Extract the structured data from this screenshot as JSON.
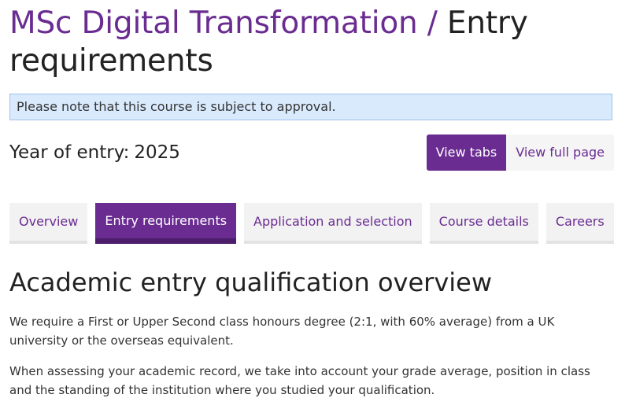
{
  "header": {
    "programme": "MSc Digital Transformation",
    "separator": " / ",
    "section": "Entry requirements"
  },
  "notice": {
    "text": "Please note that this course is subject to approval."
  },
  "entry": {
    "label": "Year of entry:",
    "year": "2025"
  },
  "view_toggle": {
    "tabs_label": "View tabs",
    "full_label": "View full page",
    "active": "tabs"
  },
  "tabs": [
    {
      "label": "Overview"
    },
    {
      "label": "Entry requirements",
      "active": true
    },
    {
      "label": "Application and selection"
    },
    {
      "label": "Course details"
    },
    {
      "label": "Careers"
    }
  ],
  "content": {
    "heading": "Academic entry qualification overview",
    "paragraphs": [
      "We require a First or Upper Second class honours degree (2:1, with 60% average) from a UK university or the overseas equivalent.",
      "When assessing your academic record, we take into account your grade average, position in class and the standing of the institution where you studied your qualification."
    ]
  },
  "colors": {
    "brand_purple": "#6a2c91",
    "notice_background": "#d9eafd",
    "notice_border": "#9cc3ec",
    "tab_background": "#f2f2f2"
  }
}
